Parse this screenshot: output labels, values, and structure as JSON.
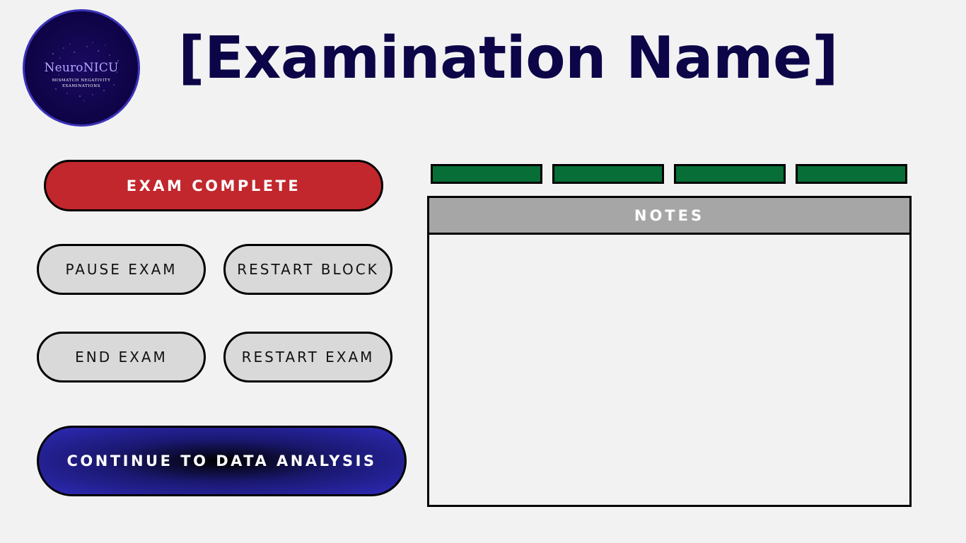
{
  "app": {
    "logo": {
      "title": "NeuroNICU",
      "subtitle_line1": "MISMATCH NEGATIVITY",
      "subtitle_line2": "EXAMINATIONS"
    },
    "title": "[Examination Name]"
  },
  "controls": {
    "exam_complete_label": "EXAM COMPLETE",
    "pause_exam_label": "PAUSE EXAM",
    "restart_block_label": "RESTART BLOCK",
    "end_exam_label": "END EXAM",
    "restart_exam_label": "RESTART EXAM",
    "continue_label": "CONTINUE TO DATA ANALYSIS"
  },
  "status_bars": {
    "count": 4,
    "color": "#066e36",
    "states": [
      "complete",
      "complete",
      "complete",
      "complete"
    ]
  },
  "notes": {
    "header": "NOTES",
    "value": ""
  },
  "colors": {
    "background": "#f2f2f2",
    "title": "#0c0548",
    "complete_button": "#c1272d",
    "secondary_button": "#d9d9d9",
    "continue_button_edge": "#2e2ab8",
    "notes_header": "#a6a6a6",
    "status_bar": "#066e36"
  }
}
